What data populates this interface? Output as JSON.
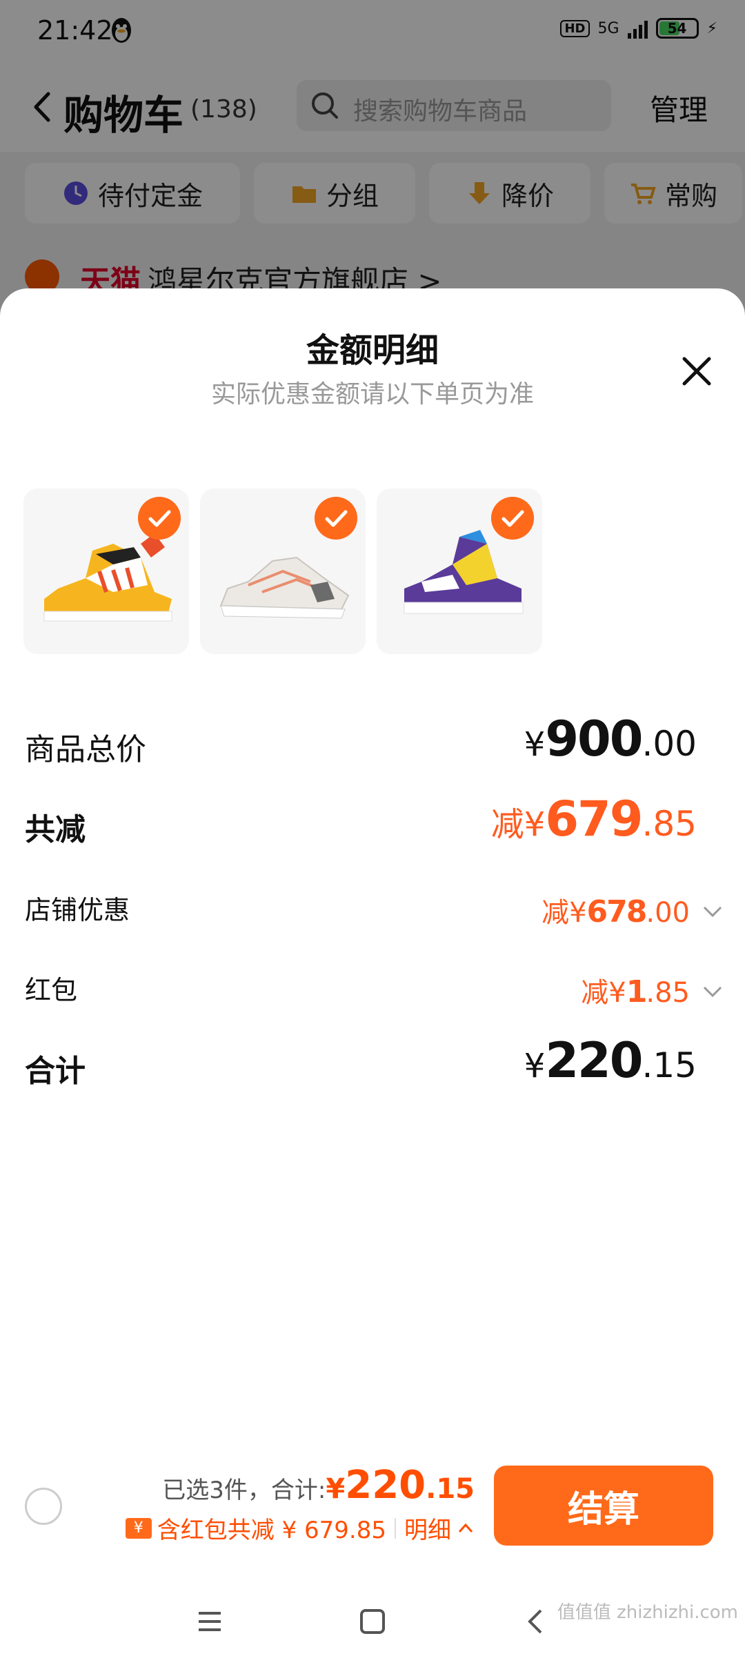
{
  "status_bar": {
    "time": "21:42",
    "network": "5G",
    "hd": "HD",
    "battery": "54"
  },
  "header": {
    "title": "购物车",
    "count": "(138)",
    "search_placeholder": "搜索购物车商品",
    "manage": "管理"
  },
  "chips": [
    {
      "label": "待付定金",
      "icon": "clock-icon"
    },
    {
      "label": "分组",
      "icon": "folder-icon"
    },
    {
      "label": "降价",
      "icon": "price-drop-icon"
    },
    {
      "label": "常购",
      "icon": "cart-icon"
    }
  ],
  "store": {
    "badge": "天猫",
    "name": "鸿星尔克官方旗舰店 >"
  },
  "sheet": {
    "title": "金额明细",
    "subtitle": "实际优惠金额请以下单页为准",
    "rows": {
      "total": {
        "label": "商品总价",
        "prefix": "",
        "cur": "¥",
        "int": "900",
        "dec": ".00"
      },
      "reduce": {
        "label": "共减",
        "prefix": "减",
        "cur": "¥",
        "int": "679",
        "dec": ".85"
      },
      "store_discount": {
        "label": "店铺优惠",
        "prefix": "减",
        "cur": "¥",
        "int": "678",
        "dec": ".00"
      },
      "red_packet": {
        "label": "红包",
        "prefix": "减",
        "cur": "¥",
        "int": "1",
        "dec": ".85"
      },
      "sum": {
        "label": "合计",
        "prefix": "",
        "cur": "¥",
        "int": "220",
        "dec": ".15"
      }
    }
  },
  "checkout": {
    "selected_text": "已选3件，合计:",
    "cur": "¥",
    "int": "220",
    "dec": ".15",
    "discount_text": "含红包共减 ¥ 679.85",
    "detail": "明细",
    "hongbao_glyph": "¥",
    "button": "结算"
  },
  "watermark": "值值值 zhizhizhi.com",
  "colors": {
    "accent": "#ff6a1a",
    "discount": "#ff5b1f",
    "tmall_red": "#e4002b"
  }
}
